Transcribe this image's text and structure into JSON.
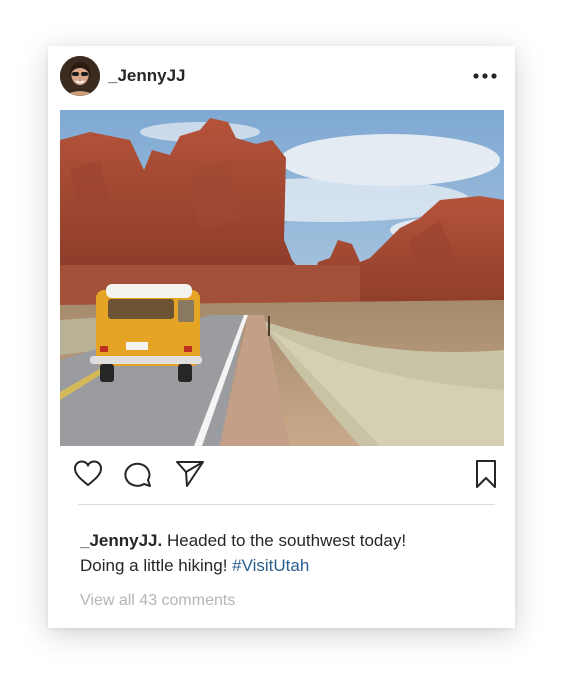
{
  "post": {
    "username": "_JennyJJ",
    "caption_user": "_JennyJJ.",
    "caption_text": " Headed to the southwest today!",
    "caption_line2": "Doing a little hiking! ",
    "hashtag": "#VisitUtah",
    "view_comments": "View all 43 comments"
  },
  "icons": {
    "more": "more-options-icon",
    "like": "heart-icon",
    "comment": "comment-icon",
    "share": "send-icon",
    "save": "bookmark-icon"
  },
  "colors": {
    "text": "#262626",
    "hashtag": "#2a5d8f",
    "muted": "#b5b5b5"
  }
}
